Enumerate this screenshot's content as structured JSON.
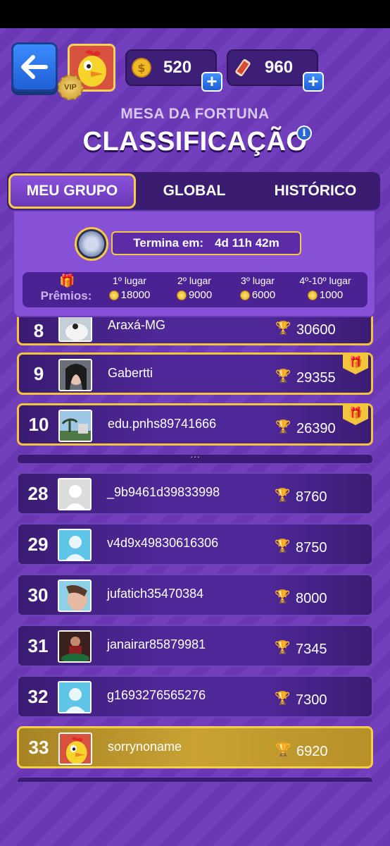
{
  "header": {
    "coins": "520",
    "tickets": "960",
    "vip_label": "VIP",
    "subtitle": "MESA DA FORTUNA",
    "title": "CLASSIFICAÇÃO",
    "info": "i"
  },
  "tabs": [
    {
      "label": "MEU GRUPO",
      "active": true
    },
    {
      "label": "GLOBAL",
      "active": false
    },
    {
      "label": "HISTÓRICO",
      "active": false
    }
  ],
  "timer": {
    "label": "Termina em:",
    "value": "4d 11h 42m"
  },
  "prizes": {
    "label": "Prêmios:",
    "items": [
      {
        "place": "1º lugar",
        "amount": "18000"
      },
      {
        "place": "2º lugar",
        "amount": "9000"
      },
      {
        "place": "3º lugar",
        "amount": "6000"
      },
      {
        "place": "4º-10º lugar",
        "amount": "1000"
      }
    ]
  },
  "top_rows": [
    {
      "rank": "8",
      "name": "Araxá-MG",
      "score": "30600",
      "avatar": "photo-white-cat"
    },
    {
      "rank": "9",
      "name": "Gabertti",
      "score": "29355",
      "avatar": "photo-woman"
    },
    {
      "rank": "10",
      "name": "edu.pnhs89741666",
      "score": "26390",
      "avatar": "photo-landscape"
    }
  ],
  "separator": "···",
  "bottom_rows": [
    {
      "rank": "28",
      "name": "_9b9461d39833998",
      "score": "8760",
      "avatar": "placeholder-gray"
    },
    {
      "rank": "29",
      "name": "v4d9x49830616306",
      "score": "8750",
      "avatar": "placeholder-blue"
    },
    {
      "rank": "30",
      "name": "jufatich35470384",
      "score": "8000",
      "avatar": "photo-person"
    },
    {
      "rank": "31",
      "name": "janairar85879981",
      "score": "7345",
      "avatar": "photo-table"
    },
    {
      "rank": "32",
      "name": "g1693276565276",
      "score": "7300",
      "avatar": "placeholder-blue"
    },
    {
      "rank": "33",
      "name": "sorrynoname",
      "score": "6920",
      "avatar": "chicken",
      "is_me": true
    }
  ],
  "colors": {
    "background": "#6a37b5",
    "gold": "#f2c53d",
    "row": "#4e2898",
    "me_row": "#c9a233"
  }
}
